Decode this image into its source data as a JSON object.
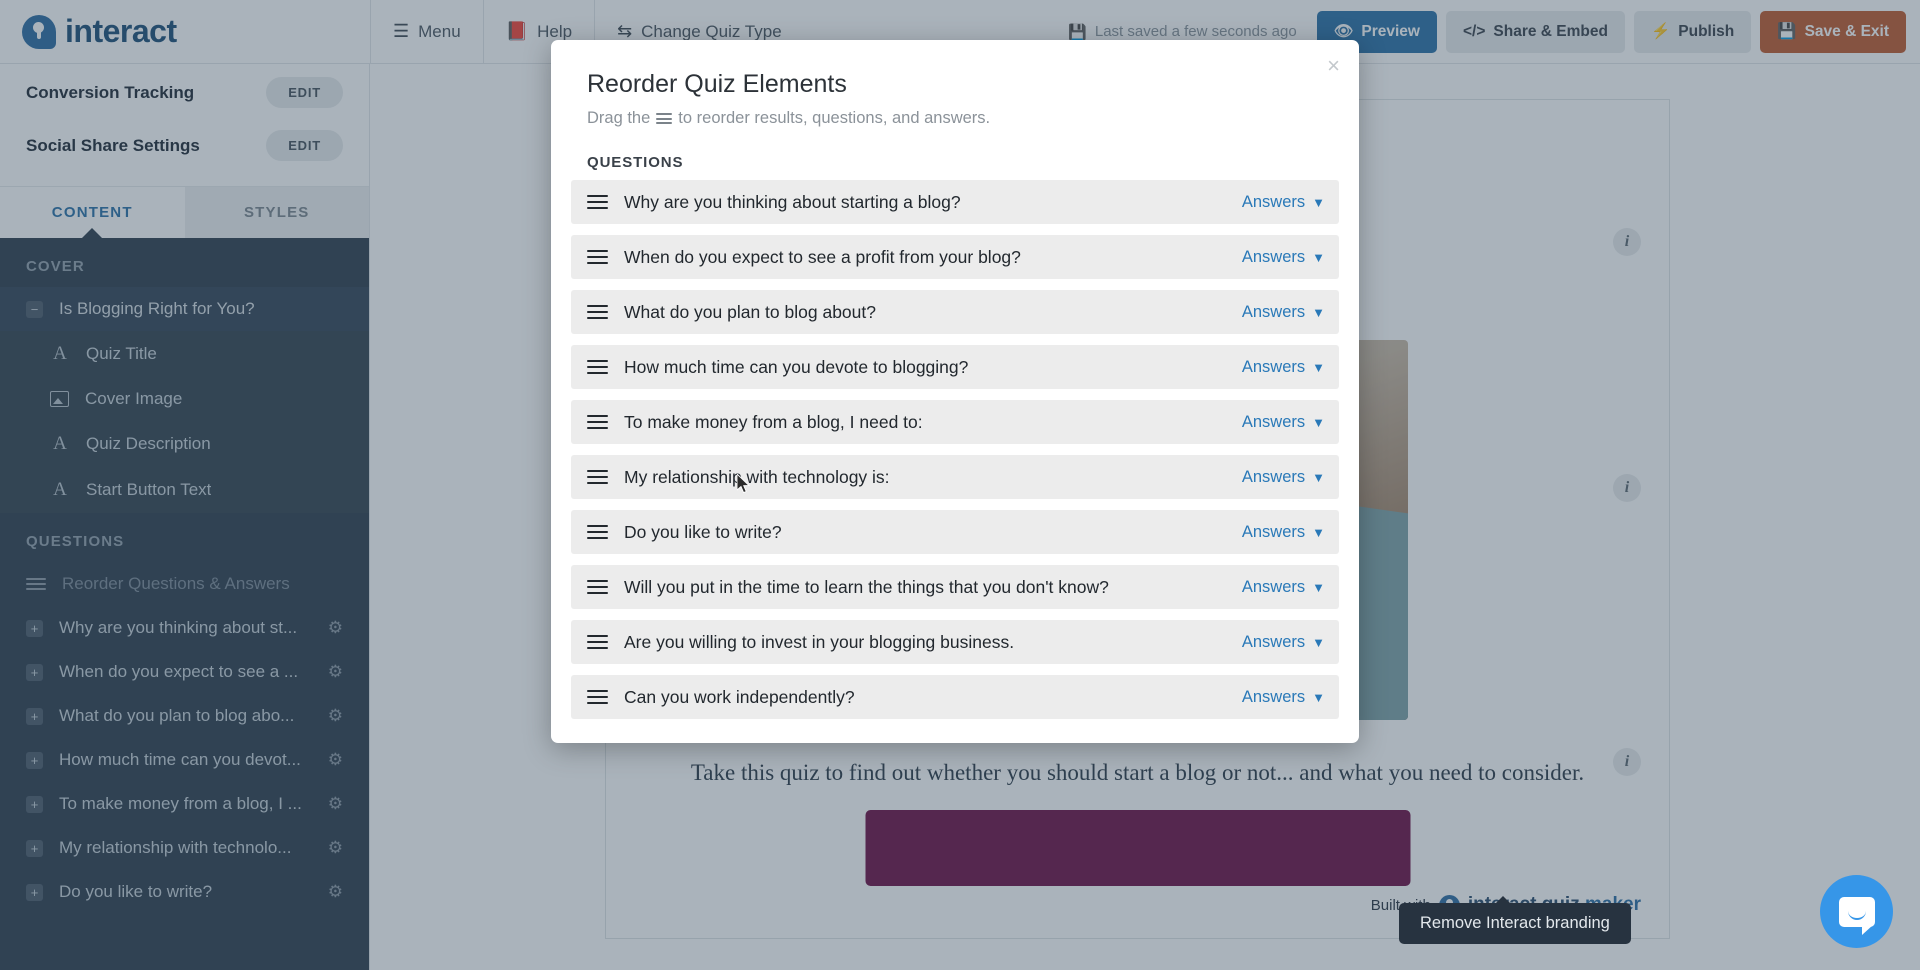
{
  "topbar": {
    "brand": "interact",
    "menu_label": "Menu",
    "help_label": "Help",
    "change_quiz_type_label": "Change Quiz Type",
    "saved_status": "Last saved a few seconds ago",
    "preview_label": "Preview",
    "share_label": "Share & Embed",
    "publish_label": "Publish",
    "save_exit_label": "Save & Exit",
    "accent_blue": "#2a71a8",
    "accent_orange": "#c05a2e"
  },
  "sidebar": {
    "settings": [
      {
        "label": "Conversion Tracking",
        "action": "EDIT"
      },
      {
        "label": "Social Share Settings",
        "action": "EDIT"
      }
    ],
    "tabs": [
      {
        "label": "CONTENT",
        "active": true
      },
      {
        "label": "STYLES",
        "active": false
      }
    ],
    "cover_section": "COVER",
    "cover_parent": "Is Blogging Right for You?",
    "cover_items": [
      {
        "label": "Quiz Title",
        "icon": "text-icon"
      },
      {
        "label": "Cover Image",
        "icon": "image-icon"
      },
      {
        "label": "Quiz Description",
        "icon": "text-icon"
      },
      {
        "label": "Start Button Text",
        "icon": "text-icon"
      }
    ],
    "questions_section": "QUESTIONS",
    "reorder_label": "Reorder Questions & Answers",
    "questions": [
      "Why are you thinking about st...",
      "When do you expect to see a ...",
      "What do you plan to blog abo...",
      "How much time can you devot...",
      "To make money from a blog, I ...",
      "My relationship with technolo...",
      "Do you like to write?"
    ]
  },
  "canvas": {
    "quiz_title": "Is Blogging Right for You?",
    "quiz_description": "Take this quiz to find out whether you should start a blog or not... and what you need to consider.",
    "built_with_prefix": "Built with",
    "built_with_brand_1": "interact quiz",
    "built_with_brand_2": " maker",
    "button_color": "#6d0f45"
  },
  "modal": {
    "title": "Reorder Quiz Elements",
    "subtitle_before": "Drag the",
    "subtitle_after": "to reorder results, questions, and answers.",
    "close_label": "×",
    "section_label": "QUESTIONS",
    "answers_label": "Answers",
    "chevron": "▼",
    "questions": [
      "Why are you thinking about starting a blog?",
      "When do you expect to see a profit from your blog?",
      "What do you plan to blog about?",
      "How much time can you devote to blogging?",
      "To make money from a blog, I need to:",
      "My relationship with technology is:",
      "Do you like to write?",
      "Will you put in the time to learn the things that you don't know?",
      "Are you willing to invest in your blogging business.",
      "Can you work independently?"
    ]
  },
  "tooltip": {
    "text": "Remove Interact branding"
  }
}
